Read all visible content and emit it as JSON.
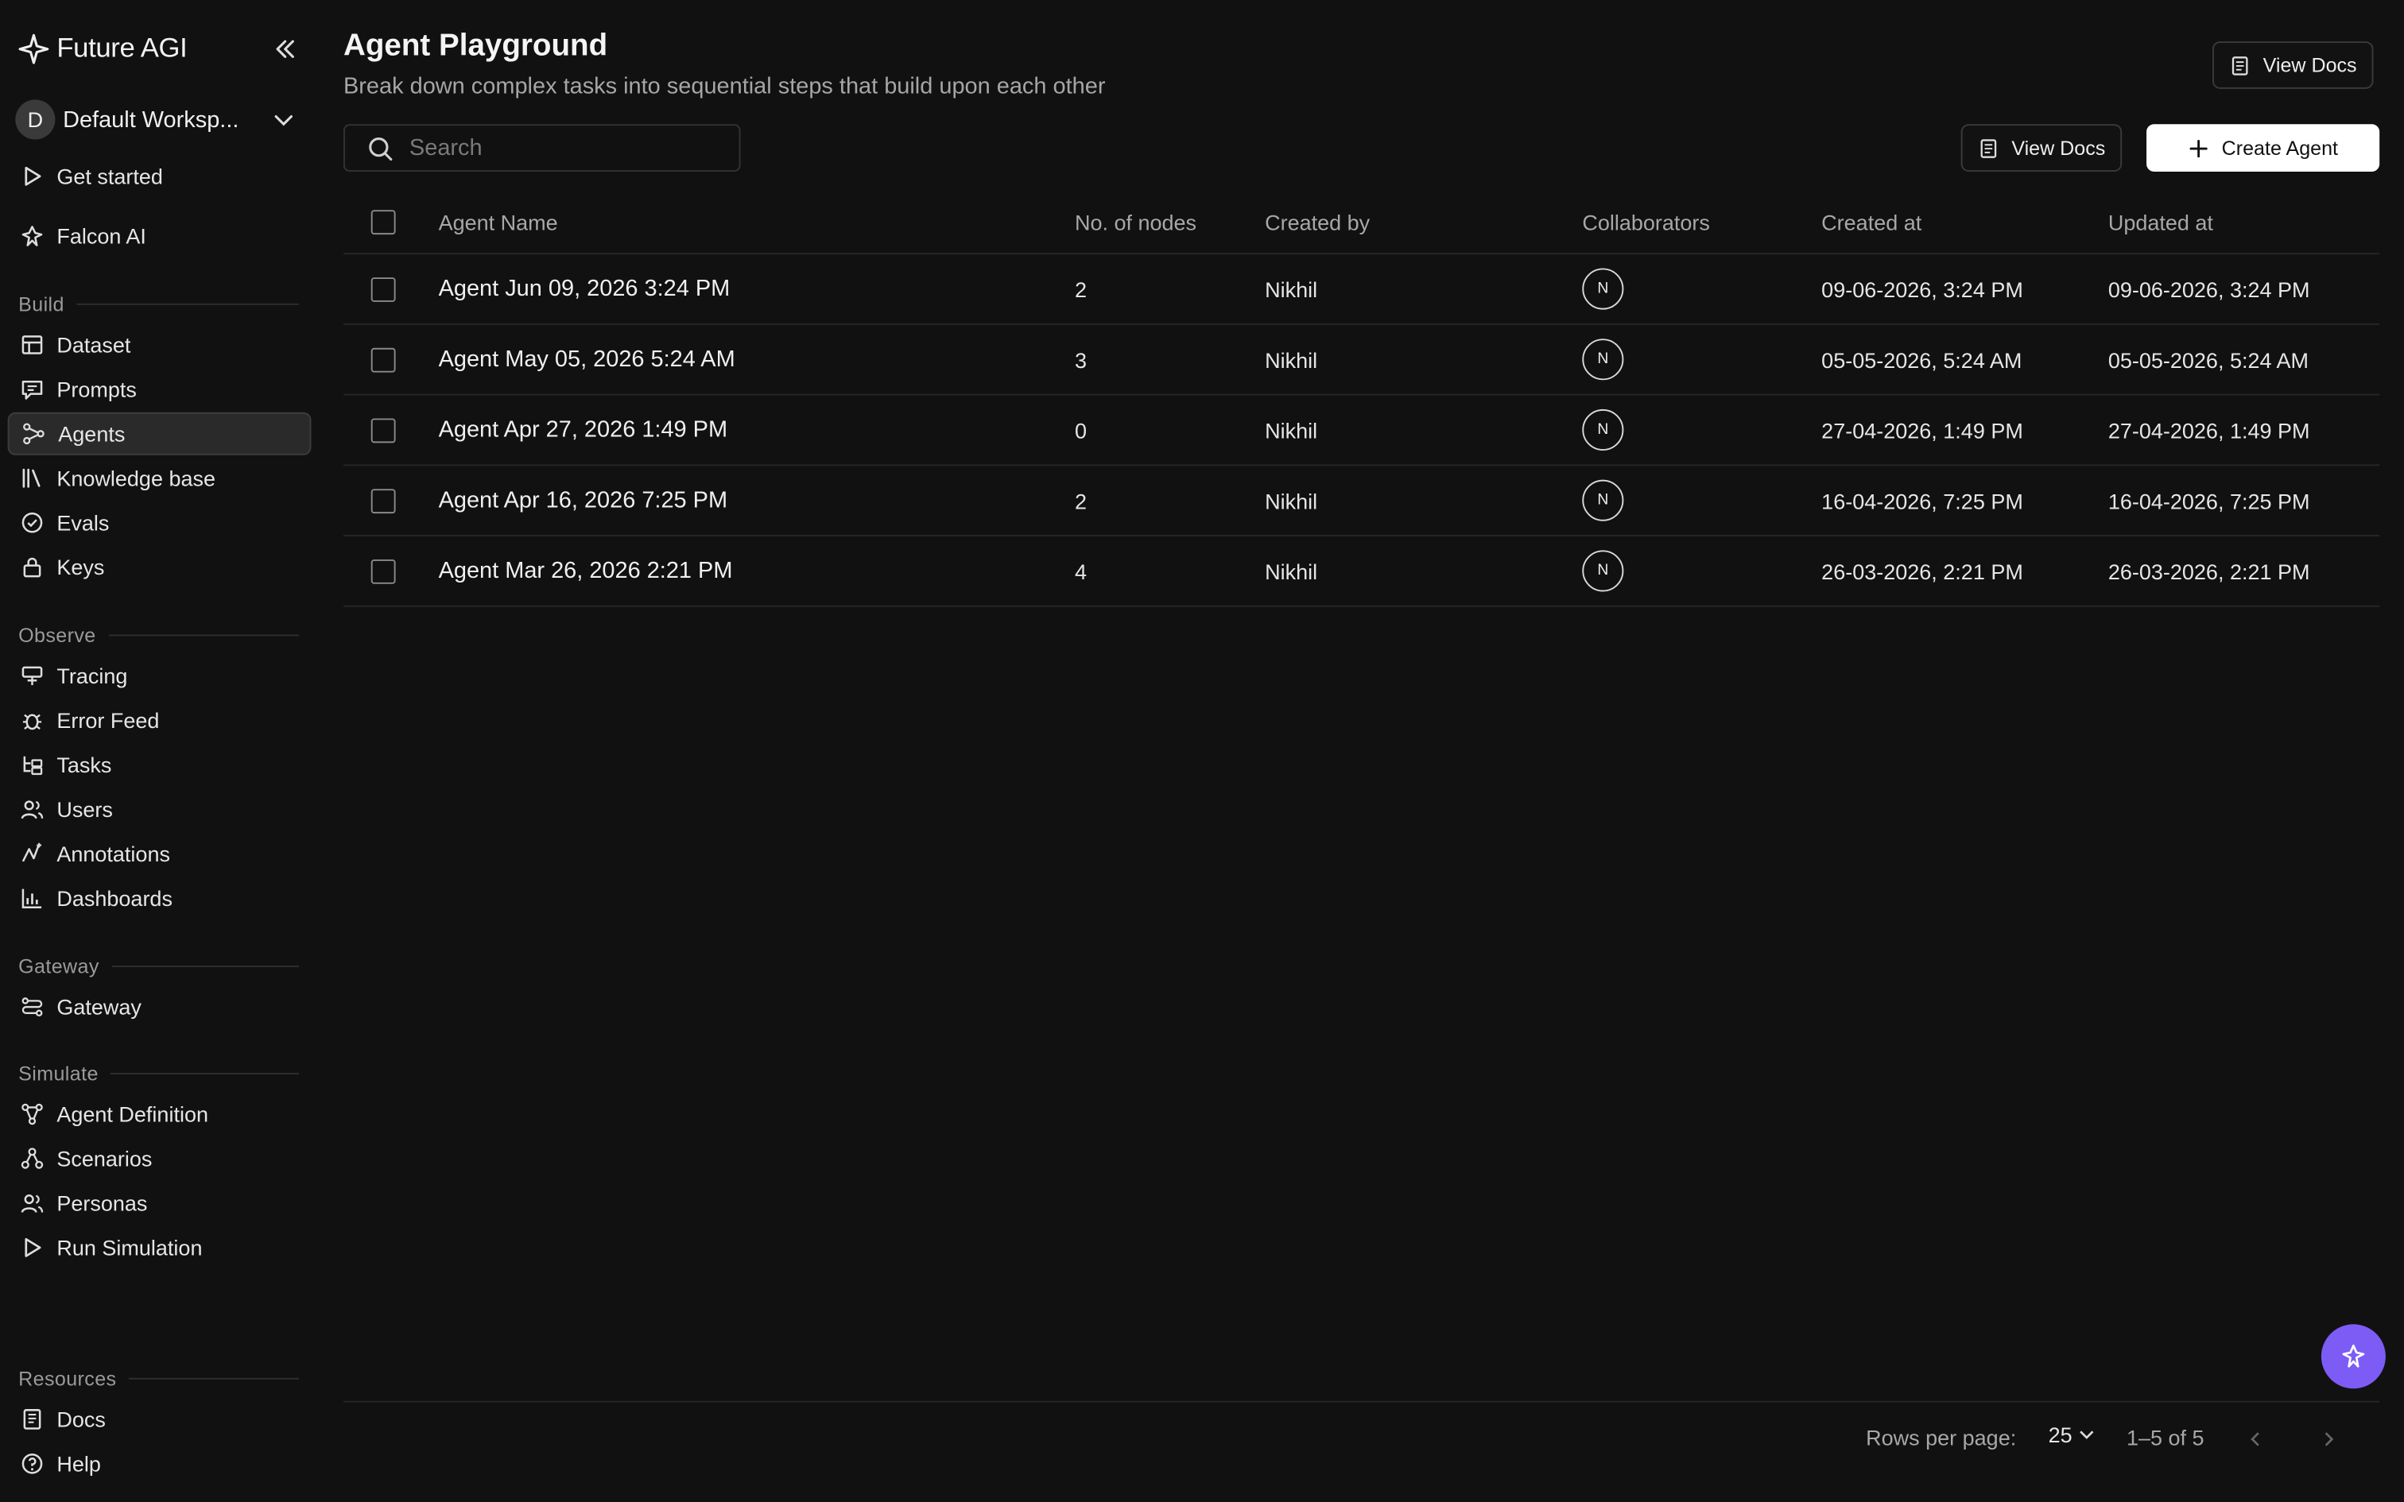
{
  "brand": {
    "name": "Future AGI"
  },
  "workspace": {
    "initial": "D",
    "name": "Default Worksp..."
  },
  "nav_top": [
    {
      "label": "Get started",
      "icon": "play-icon"
    },
    {
      "label": "Falcon AI",
      "icon": "falcon-icon"
    }
  ],
  "sections": {
    "build": "Build",
    "observe": "Observe",
    "gateway": "Gateway",
    "simulate": "Simulate",
    "resources": "Resources"
  },
  "nav_build": [
    {
      "label": "Dataset"
    },
    {
      "label": "Prompts"
    },
    {
      "label": "Agents",
      "active": true
    },
    {
      "label": "Knowledge base"
    },
    {
      "label": "Evals"
    },
    {
      "label": "Keys"
    }
  ],
  "nav_observe": [
    {
      "label": "Tracing"
    },
    {
      "label": "Error Feed"
    },
    {
      "label": "Tasks"
    },
    {
      "label": "Users"
    },
    {
      "label": "Annotations"
    },
    {
      "label": "Dashboards"
    }
  ],
  "nav_gateway": [
    {
      "label": "Gateway"
    }
  ],
  "nav_simulate": [
    {
      "label": "Agent Definition"
    },
    {
      "label": "Scenarios"
    },
    {
      "label": "Personas"
    },
    {
      "label": "Run Simulation"
    }
  ],
  "nav_resources": [
    {
      "label": "Docs"
    },
    {
      "label": "Help"
    }
  ],
  "header": {
    "title": "Agent Playground",
    "subtitle": "Break down complex tasks into sequential steps that build upon each other",
    "view_docs": "View Docs"
  },
  "toolbar": {
    "search_placeholder": "Search",
    "view_docs": "View Docs",
    "create_agent": "Create Agent"
  },
  "table": {
    "columns": [
      "Agent Name",
      "No. of nodes",
      "Created by",
      "Collaborators",
      "Created at",
      "Updated at"
    ],
    "rows": [
      {
        "name": "Agent Jun 09, 2026 3:24 PM",
        "nodes": "2",
        "created_by": "Nikhil",
        "collaborator": "N",
        "created_at": "09-06-2026, 3:24 PM",
        "updated_at": "09-06-2026, 3:24 PM"
      },
      {
        "name": "Agent May 05, 2026 5:24 AM",
        "nodes": "3",
        "created_by": "Nikhil",
        "collaborator": "N",
        "created_at": "05-05-2026, 5:24 AM",
        "updated_at": "05-05-2026, 5:24 AM"
      },
      {
        "name": "Agent Apr 27, 2026 1:49 PM",
        "nodes": "0",
        "created_by": "Nikhil",
        "collaborator": "N",
        "created_at": "27-04-2026, 1:49 PM",
        "updated_at": "27-04-2026, 1:49 PM"
      },
      {
        "name": "Agent Apr 16, 2026 7:25 PM",
        "nodes": "2",
        "created_by": "Nikhil",
        "collaborator": "N",
        "created_at": "16-04-2026, 7:25 PM",
        "updated_at": "16-04-2026, 7:25 PM"
      },
      {
        "name": "Agent Mar 26, 2026 2:21 PM",
        "nodes": "4",
        "created_by": "Nikhil",
        "collaborator": "N",
        "created_at": "26-03-2026, 2:21 PM",
        "updated_at": "26-03-2026, 2:21 PM"
      }
    ]
  },
  "pagination": {
    "rows_per_page_label": "Rows per page:",
    "rows_per_page": "25",
    "range": "1–5 of 5"
  },
  "colors": {
    "background": "#111111",
    "accent": "#7c5cf5",
    "primary_button": "#ffffff"
  }
}
